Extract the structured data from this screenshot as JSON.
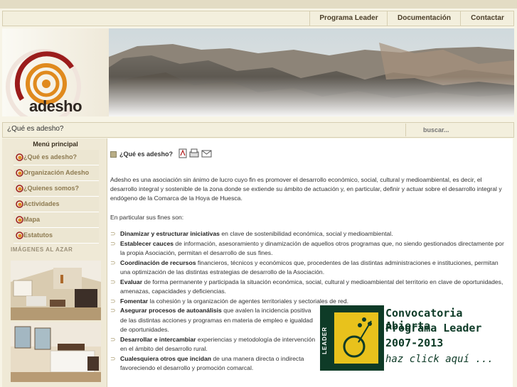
{
  "nav": {
    "items": [
      "Programa Leader",
      "Documentación",
      "Contactar"
    ]
  },
  "logo": {
    "text": "adesho"
  },
  "breadcrumb": "¿Qué es adesho?",
  "search": {
    "placeholder": "buscar..."
  },
  "sidebar": {
    "title": "Menú principal",
    "items": [
      {
        "label": "¿Qué es adesho?"
      },
      {
        "label": "Organización Adesho"
      },
      {
        "label": "¿Quienes somos?"
      },
      {
        "label": "Actividades"
      },
      {
        "label": "Mapa"
      },
      {
        "label": "Estatutos"
      }
    ],
    "images_title": "IMÁGENES AL AZAR"
  },
  "content": {
    "title": "¿Qué es adesho?",
    "intro": "Adesho es una asociación sin ánimo de lucro cuyo fin es promover el desarrollo económico, social, cultural y medioambiental, es decir, el desarrollo integral y sostenible de la zona donde se extiende su ámbito de actuación y, en particular, definir y actuar sobre el desarrollo integral y endógeno de la Comarca de la Hoya de Huesca.",
    "lead": "En particular sus fines son:",
    "items": [
      {
        "bold": "Dinamizar y estructurar iniciativas",
        "text": " en clave de sostenibilidad económica, social y medioambiental."
      },
      {
        "bold": "Establecer cauces",
        "text": " de información, asesoramiento y dinamización de aquellos otros programas que, no siendo gestionados directamente por la propia Asociación, permitan el desarrollo de sus fines."
      },
      {
        "bold": "Coordinación de recursos",
        "text": " financieros, técnicos y económicos que, procedentes de las distintas administraciones e instituciones, permitan una optimización de las distintas estrategias de desarrollo de la Asociación."
      },
      {
        "bold": "Evaluar",
        "text": " de forma permanente y participada la situación económica, social, cultural y medioambiental del territorio en clave de oportunidades, amenazas, capacidades y deficiencias."
      },
      {
        "bold": "Fomentar",
        "text": " la cohesión y la organización de agentes territoriales y sectoriales de red."
      },
      {
        "bold": "Asegurar procesos de autoanálisis",
        "text": " que avalen la incidencia positiva de las distintas acciones y programas en materia de empleo e igualdad de oportunidades."
      },
      {
        "bold": "Desarrollar e intercambiar",
        "text": " experiencias y metodología de intervención en el ámbito del desarrollo rural."
      },
      {
        "bold": "Cualesquiera otros que incidan",
        "text": " de una manera directa o indirecta favoreciendo el desarrollo y promoción comarcal."
      }
    ]
  },
  "leader_banner": {
    "logo_text": "LEADER",
    "line1": "Convocatoria Abierta",
    "line2": "Programa Leader",
    "line3": "2007-2013",
    "line4": "haz click aquí ..."
  },
  "colors": {
    "background": "#f7f4e6",
    "accent_red": "#9b1c1c",
    "accent_orange": "#e08a1e",
    "leader_green": "#0e3b27",
    "leader_yellow": "#e8c21c"
  }
}
